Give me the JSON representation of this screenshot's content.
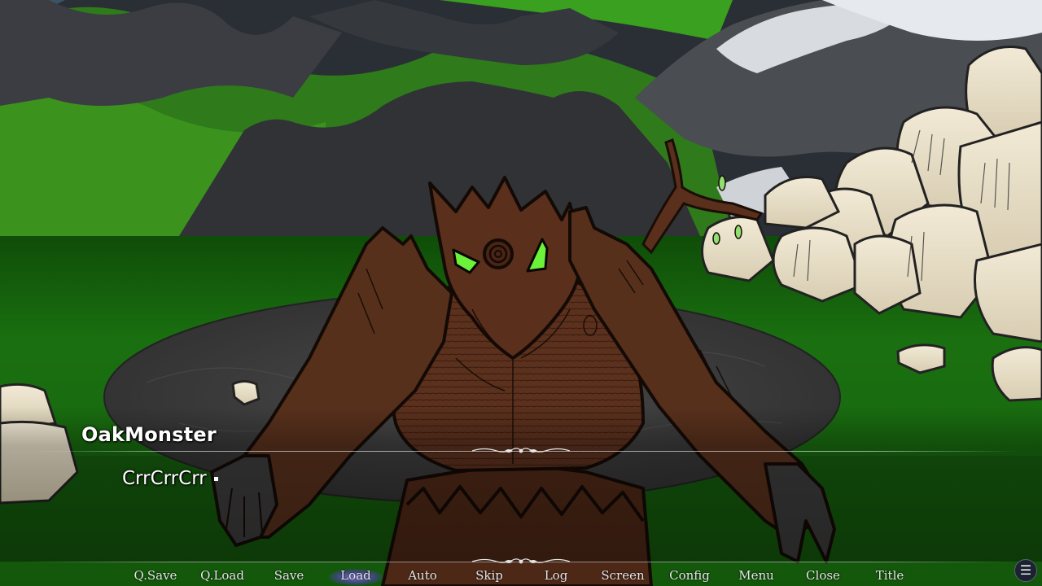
{
  "dialogue": {
    "speaker": "OakMonster",
    "text": "CrrCrrCrr"
  },
  "quick_menu": {
    "items": [
      {
        "label": "Q.Save"
      },
      {
        "label": "Q.Load"
      },
      {
        "label": "Save"
      },
      {
        "label": "Load",
        "active": true
      },
      {
        "label": "Auto"
      },
      {
        "label": "Skip"
      },
      {
        "label": "Log"
      },
      {
        "label": "Screen"
      },
      {
        "label": "Config"
      },
      {
        "label": "Menu"
      },
      {
        "label": "Close"
      },
      {
        "label": "Title"
      }
    ],
    "menu_icon": "hamburger-menu-icon"
  },
  "colors": {
    "grass": "#1f7a12",
    "arena": "#3a3a3a",
    "wood": "#5a2f1c",
    "eye": "#6cf23a",
    "highlight": "#7a5cf0"
  }
}
